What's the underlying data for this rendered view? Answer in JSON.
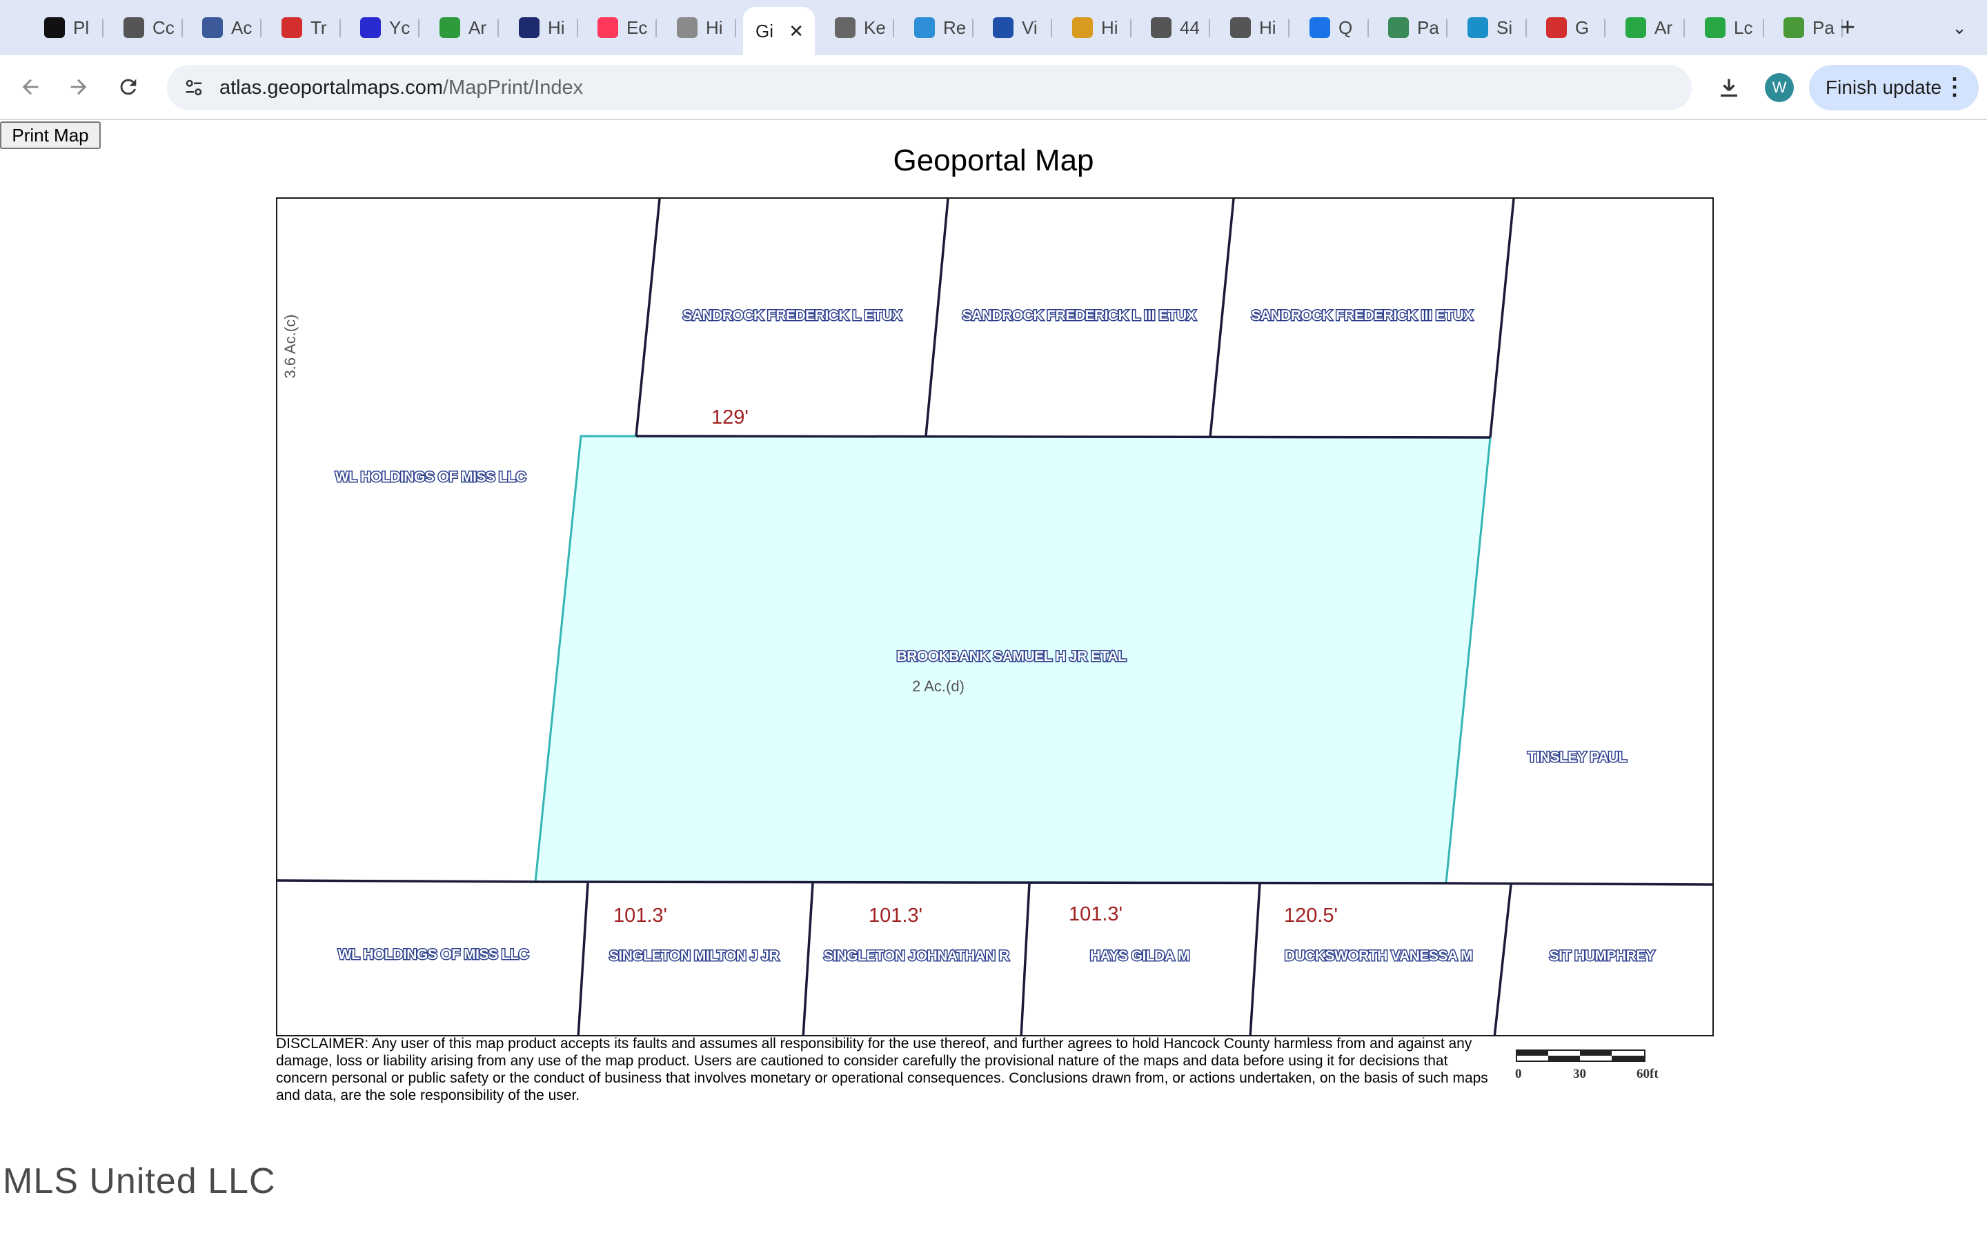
{
  "browser": {
    "tabs": [
      {
        "title": "Pl",
        "icon": "app-icon",
        "color": "#111111"
      },
      {
        "title": "Cc",
        "icon": "globe-icon",
        "color": "#555555"
      },
      {
        "title": "Ac",
        "icon": "upload-icon",
        "color": "#3c5a99"
      },
      {
        "title": "Tr",
        "icon": "brand-icon",
        "color": "#d32f2f"
      },
      {
        "title": "Yc",
        "icon": "brand-icon",
        "color": "#2a2ad1"
      },
      {
        "title": "Ar",
        "icon": "leaf-icon",
        "color": "#2e9a3c"
      },
      {
        "title": "Hi",
        "icon": "brand-icon",
        "color": "#1e2a6e"
      },
      {
        "title": "Ec",
        "icon": "airbnb-icon",
        "color": "#ff385c"
      },
      {
        "title": "Hi",
        "icon": "document-icon",
        "color": "#8a8a8a"
      },
      {
        "title": "Gi",
        "icon": "none",
        "color": "#ffffff",
        "active": true
      },
      {
        "title": "Ke",
        "icon": "gauge-icon",
        "color": "#666666"
      },
      {
        "title": "Re",
        "icon": "brand-icon",
        "color": "#2f8ed8"
      },
      {
        "title": "Vi",
        "icon": "check-icon",
        "color": "#1f4fa8"
      },
      {
        "title": "Hi",
        "icon": "brand-icon",
        "color": "#d99a20"
      },
      {
        "title": "44",
        "icon": "globe-icon",
        "color": "#555555"
      },
      {
        "title": "Hi",
        "icon": "globe-icon",
        "color": "#555555"
      },
      {
        "title": "Q",
        "icon": "circle-icon",
        "color": "#1a73e8"
      },
      {
        "title": "Pa",
        "icon": "gauge-icon",
        "color": "#3a8a5a"
      },
      {
        "title": "Si",
        "icon": "brand-icon",
        "color": "#1b8fc7"
      },
      {
        "title": "G",
        "icon": "brand-icon",
        "color": "#d32f2f"
      },
      {
        "title": "Ar",
        "icon": "sheet-icon",
        "color": "#27a844"
      },
      {
        "title": "Lc",
        "icon": "sheet-icon",
        "color": "#27a844"
      },
      {
        "title": "Pa",
        "icon": "brand-icon",
        "color": "#4a9a3a"
      }
    ],
    "active_close": "✕",
    "new_tab": "+",
    "tab_search": "⌄",
    "url": "atlas.geoportalmaps.com/MapPrint/Index",
    "url_host": "atlas.geoportalmaps.com",
    "url_path": "/MapPrint/Index",
    "avatar_letter": "W",
    "finish_update": "Finish update"
  },
  "page": {
    "print_button": "Print Map",
    "title": "Geoportal Map",
    "disclaimer": "DISCLAIMER: Any user of this map product accepts its faults and assumes all responsibility for the use thereof, and further agrees to hold Hancock County harmless from and against any damage, loss or liability arising from any use of the map product. Users are cautioned to consider carefully the provisional nature of the maps and data before using it for decisions that concern personal or public safety or the conduct of business that involves monetary or operational consequences. Conclusions drawn from, or actions undertaken, on the basis of such maps and data, are the sole responsibility of the user.",
    "scale": {
      "labels": [
        "0",
        "30",
        "60ft"
      ]
    },
    "watermark": "MLS United LLC"
  },
  "map": {
    "highlight_color": "#e0ffff",
    "highlight_stroke": "#33b5b5",
    "line_color": "#1a1a3a",
    "owners": {
      "top_1": "SANDROCK FREDERICK L ETUX",
      "top_2": "SANDROCK FREDERICK L III ETUX",
      "top_3": "SANDROCK FREDERICK III ETUX",
      "left": "WL HOLDINGS OF MISS LLC",
      "subject": "BROOKBANK SAMUEL H JR ETAL",
      "right": "TINSLEY PAUL",
      "bottom_1": "WL HOLDINGS OF MISS LLC",
      "bottom_2": "SINGLETON MILTON J JR",
      "bottom_3": "SINGLETON JOHNATHAN R",
      "bottom_4": "HAYS GILDA M",
      "bottom_5": "DUCKSWORTH VANESSA M",
      "bottom_6": "SIT HUMPHREY"
    },
    "acreage": {
      "left": "3.6 Ac.(c)",
      "subject": "2 Ac.(d)"
    },
    "dimensions": {
      "top": "129'",
      "bottom_1": "101.3'",
      "bottom_2": "101.3'",
      "bottom_3": "101.3'",
      "bottom_4": "120.5'"
    }
  }
}
